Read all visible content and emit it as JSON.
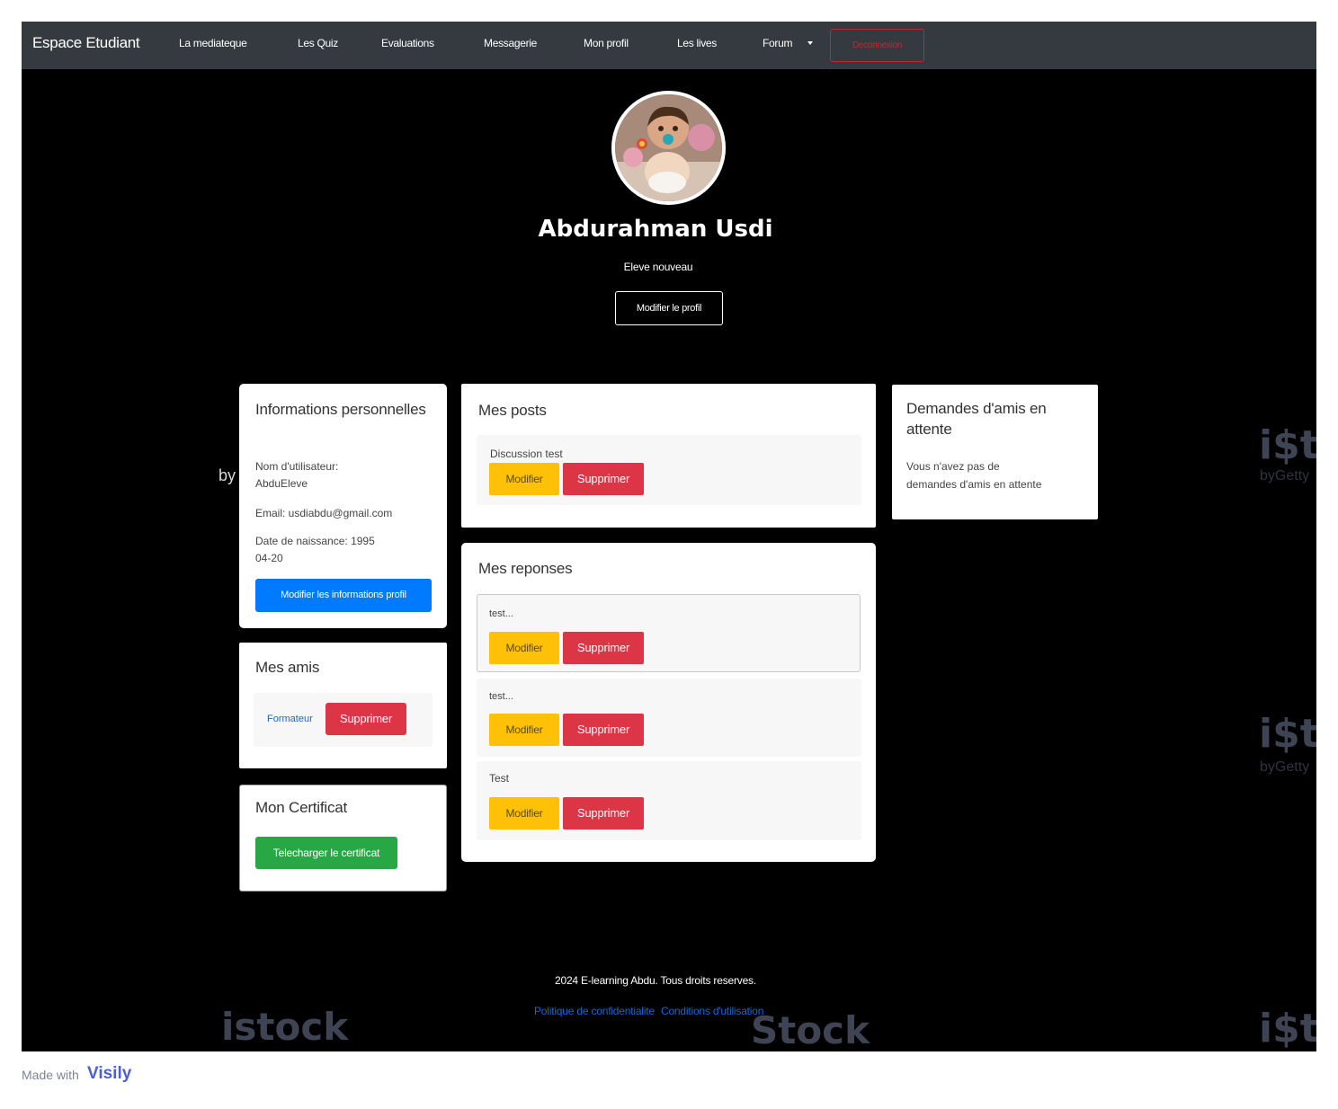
{
  "navbar": {
    "brand": "Espace Etudiant",
    "links": [
      "La mediateque",
      "Les Quiz",
      "Evaluations",
      "Messagerie",
      "Mon profil",
      "Les lives",
      "Forum"
    ],
    "logout_label": "Deconnexion"
  },
  "profile": {
    "name": "Abdurahman Usdi",
    "role": "Eleve nouveau",
    "edit_label": "Modifier le profil"
  },
  "info_card": {
    "title": "Informations personnelles",
    "username_label": "Nom d'utilisateur:",
    "username": "AbduEleve",
    "email": "Email: usdiabdu@gmail.com",
    "birthdate_line1": "Date de naissance: 1995",
    "birthdate_line2": "04-20",
    "edit_label": "Modifier les informations profil"
  },
  "friends_card": {
    "title": "Mes amis",
    "friends": [
      {
        "name": "Formateur",
        "action": "Supprimer"
      }
    ]
  },
  "certificate_card": {
    "title": "Mon Certificat",
    "download_label": "Telecharger le certificat"
  },
  "posts_card": {
    "title": "Mes posts",
    "posts": [
      {
        "title": "Discussion test",
        "edit": "Modifier",
        "delete": "Supprimer"
      }
    ]
  },
  "replies_card": {
    "title": "Mes reponses",
    "replies": [
      {
        "text": "test...",
        "edit": "Modifier",
        "delete": "Supprimer"
      },
      {
        "text": "test...",
        "edit": "Modifier",
        "delete": "Supprimer"
      },
      {
        "text": "Test",
        "edit": "Modifier",
        "delete": "Supprimer"
      }
    ]
  },
  "requests_card": {
    "title": "Demandes d'amis en attente",
    "empty_line1": "Vous n'avez pas de",
    "empty_line2": "demandes d'amis en attente"
  },
  "footer": {
    "copyright": "2024 E-learning Abdu. Tous droits reserves.",
    "privacy": "Politique de confidentialite",
    "terms": "Conditions d'utilisation"
  },
  "watermarks": {
    "istock": "istock",
    "stock": "Stock",
    "ist": "i$t",
    "by": "by",
    "bygetty": "byGetty"
  },
  "badge": {
    "made_with": "Made with",
    "brand": "Visily"
  }
}
